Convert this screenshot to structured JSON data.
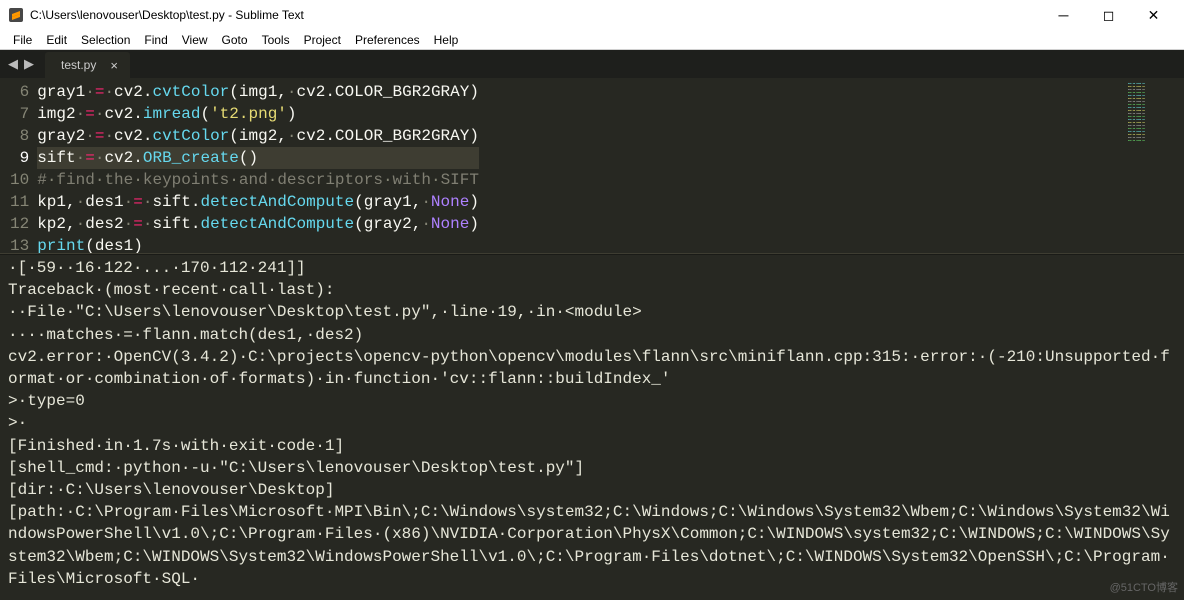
{
  "window": {
    "title": "C:\\Users\\lenovouser\\Desktop\\test.py - Sublime Text"
  },
  "menu": [
    "File",
    "Edit",
    "Selection",
    "Find",
    "View",
    "Goto",
    "Tools",
    "Project",
    "Preferences",
    "Help"
  ],
  "tab": {
    "name": "test.py"
  },
  "code": {
    "lines": [
      {
        "n": 6,
        "html": "<span class='c-var'>gray1</span><span class='dot'>·</span><span class='c-op'>=</span><span class='dot'>·</span><span class='c-mod'>cv2</span>.<span class='c-fn'>cvtColor</span><span class='c-par'>(</span>img1,<span class='dot'>·</span>cv2.COLOR_BGR2GRAY<span class='c-par'>)</span>"
      },
      {
        "n": 7,
        "html": "<span class='c-var'>img2</span><span class='dot'>·</span><span class='c-op'>=</span><span class='dot'>·</span><span class='c-mod'>cv2</span>.<span class='c-fn'>imread</span><span class='c-par'>(</span><span class='c-str'>'t2.png'</span><span class='c-par'>)</span>"
      },
      {
        "n": 8,
        "html": "<span class='c-var'>gray2</span><span class='dot'>·</span><span class='c-op'>=</span><span class='dot'>·</span><span class='c-mod'>cv2</span>.<span class='c-fn'>cvtColor</span><span class='c-par'>(</span>img2,<span class='dot'>·</span>cv2.COLOR_BGR2GRAY<span class='c-par'>)</span>"
      },
      {
        "n": 9,
        "active": true,
        "html": "<span class='c-var'>sift</span><span class='dot'>·</span><span class='c-op'>=</span><span class='dot'>·</span><span class='c-mod'>cv2</span>.<span class='c-fn'>ORB_create</span><span class='c-par'>()</span>"
      },
      {
        "n": 10,
        "html": "<span class='c-comment'>#<span class='dot'>·</span>find<span class='dot'>·</span>the<span class='dot'>·</span>keypoints<span class='dot'>·</span>and<span class='dot'>·</span>descriptors<span class='dot'>·</span>with<span class='dot'>·</span>SIFT</span>"
      },
      {
        "n": 11,
        "html": "kp1,<span class='dot'>·</span>des1<span class='dot'>·</span><span class='c-op'>=</span><span class='dot'>·</span>sift.<span class='c-fn'>detectAndCompute</span><span class='c-par'>(</span>gray1,<span class='dot'>·</span><span class='c-const'>None</span><span class='c-par'>)</span>"
      },
      {
        "n": 12,
        "html": "kp2,<span class='dot'>·</span>des2<span class='dot'>·</span><span class='c-op'>=</span><span class='dot'>·</span>sift.<span class='c-fn'>detectAndCompute</span><span class='c-par'>(</span>gray2,<span class='dot'>·</span><span class='c-const'>None</span><span class='c-par'>)</span>"
      },
      {
        "n": 13,
        "html": "<span class='c-fn'>print</span><span class='c-par'>(</span>des1<span class='c-par'>)</span>"
      }
    ]
  },
  "console_lines": [
    "·[·59··16·122·...·170·112·241]]",
    "",
    "Traceback·(most·recent·call·last):",
    "··File·\"C:\\Users\\lenovouser\\Desktop\\test.py\",·line·19,·in·<module>",
    "····matches·=·flann.match(des1,·des2)",
    "cv2.error:·OpenCV(3.4.2)·C:\\projects\\opencv-python\\opencv\\modules\\flann\\src\\miniflann.cpp:315:·error:·(-210:Unsupported·format·or·combination·of·formats)·in·function·'cv::flann::buildIndex_'",
    ">·type=0",
    ">·",
    "[Finished·in·1.7s·with·exit·code·1]",
    "[shell_cmd:·python·-u·\"C:\\Users\\lenovouser\\Desktop\\test.py\"]",
    "[dir:·C:\\Users\\lenovouser\\Desktop]",
    "[path:·C:\\Program·Files\\Microsoft·MPI\\Bin\\;C:\\Windows\\system32;C:\\Windows;C:\\Windows\\System32\\Wbem;C:\\Windows\\System32\\WindowsPowerShell\\v1.0\\;C:\\Program·Files·(x86)\\NVIDIA·Corporation\\PhysX\\Common;C:\\WINDOWS\\system32;C:\\WINDOWS;C:\\WINDOWS\\System32\\Wbem;C:\\WINDOWS\\System32\\WindowsPowerShell\\v1.0\\;C:\\Program·Files\\dotnet\\;C:\\WINDOWS\\System32\\OpenSSH\\;C:\\Program·Files\\Microsoft·SQL·"
  ],
  "watermark": "@51CTO博客"
}
